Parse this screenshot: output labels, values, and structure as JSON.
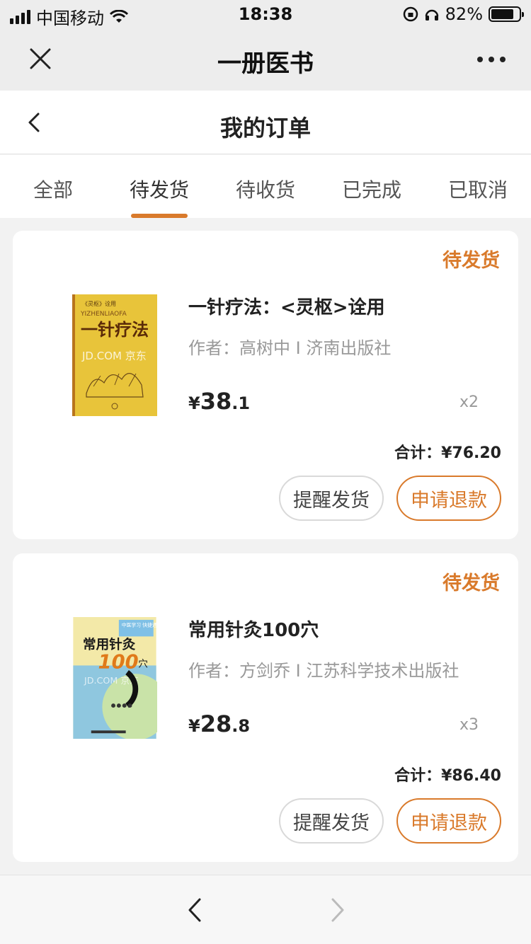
{
  "status_bar": {
    "carrier": "中国移动",
    "time": "18:38",
    "battery": "82%",
    "battery_level": 0.82
  },
  "app_bar": {
    "title": "一册医书",
    "close_icon": "close-icon",
    "more_icon": "more-icon"
  },
  "page": {
    "title": "我的订单",
    "back_icon": "chevron-left-icon"
  },
  "tabs": [
    {
      "label": "全部",
      "active": false
    },
    {
      "label": "待发货",
      "active": true
    },
    {
      "label": "待收货",
      "active": false
    },
    {
      "label": "已完成",
      "active": false
    },
    {
      "label": "已取消",
      "active": false
    }
  ],
  "orders": [
    {
      "status": "待发货",
      "book_title": "一针疗法：<灵枢>诠用",
      "author_line": "作者：高树中 I 济南出版社",
      "price_currency": "¥",
      "price_int": "38",
      "price_dec": ".1",
      "quantity": "x2",
      "total_label": "合计：",
      "total_value": "¥76.20",
      "btn_remind": "提醒发货",
      "btn_refund": "申请退款",
      "cover": {
        "series": "《灵枢》诠用",
        "pinyin": "YIZHENLIAOFA",
        "title": "一针疗法",
        "watermark": "JD.COM 京东"
      }
    },
    {
      "status": "待发货",
      "book_title": "常用针灸100穴",
      "author_line": "作者：方剑乔 I 江苏科学技术出版社",
      "price_currency": "¥",
      "price_int": "28",
      "price_dec": ".8",
      "quantity": "x3",
      "total_label": "合计：",
      "total_value": "¥86.40",
      "btn_remind": "提醒发货",
      "btn_refund": "申请退款",
      "cover": {
        "series": "中医学习 快捷通丛书",
        "title": "常用针灸",
        "number": "100",
        "suffix": "穴",
        "watermark": "JD.COM 京东"
      }
    }
  ],
  "browser_bar": {
    "prev_icon": "chevron-left-icon",
    "next_icon": "chevron-right-icon"
  },
  "colors": {
    "accent": "#d97a2b",
    "background": "#f2f2f2",
    "muted_text": "#999999"
  }
}
